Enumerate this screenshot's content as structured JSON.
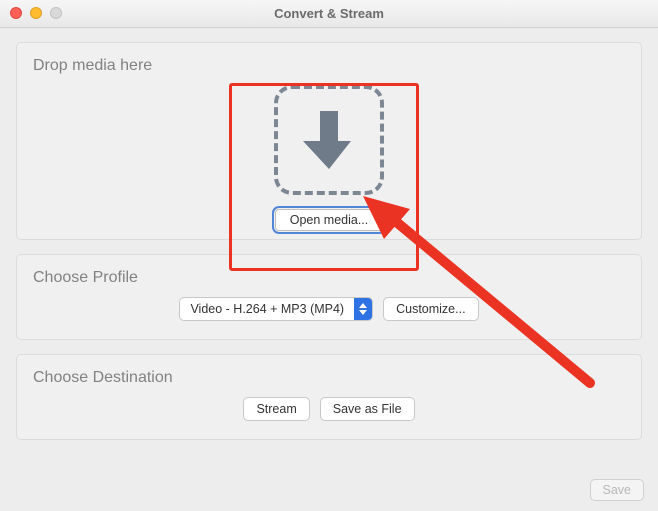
{
  "window": {
    "title": "Convert & Stream"
  },
  "drop": {
    "title": "Drop media here",
    "open_label": "Open media..."
  },
  "profile": {
    "title": "Choose Profile",
    "selected": "Video - H.264 + MP3 (MP4)",
    "customize_label": "Customize..."
  },
  "destination": {
    "title": "Choose Destination",
    "stream_label": "Stream",
    "save_file_label": "Save as File"
  },
  "footer": {
    "save_label": "Save"
  },
  "colors": {
    "annotation": "#ea3323",
    "accent_blue": "#2f72e4"
  }
}
